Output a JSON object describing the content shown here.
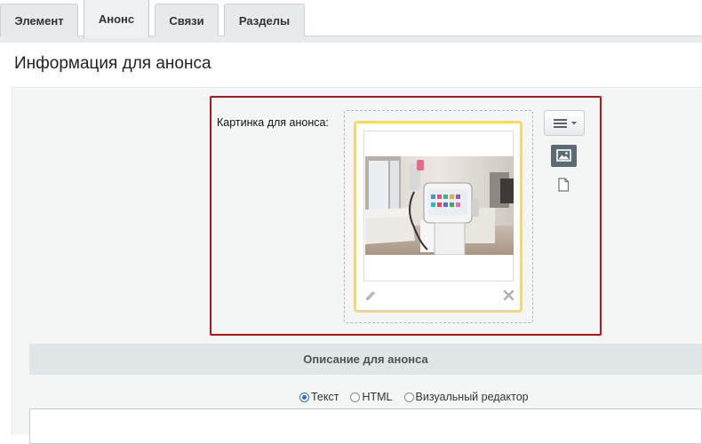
{
  "tabs": [
    {
      "label": "Элемент",
      "active": false
    },
    {
      "label": "Анонс",
      "active": true
    },
    {
      "label": "Связи",
      "active": false
    },
    {
      "label": "Разделы",
      "active": false
    }
  ],
  "section": {
    "title": "Информация для анонса"
  },
  "preview_image": {
    "label": "Картинка для анонса:",
    "edit_icon": "pencil-icon",
    "delete_icon": "close-icon"
  },
  "side_toolbar": {
    "menu_icon": "hamburger-menu-icon",
    "image_mode_icon": "image-icon",
    "file_mode_icon": "file-icon"
  },
  "description": {
    "header": "Описание для анонса",
    "modes": [
      {
        "label": "Текст",
        "checked": true
      },
      {
        "label": "HTML",
        "checked": false
      },
      {
        "label": "Визуальный редактор",
        "checked": false
      }
    ],
    "value": ""
  },
  "colors": {
    "highlight_frame": "#b9121b",
    "thumb_border": "#f1db70",
    "radio_accent": "#2c73c9"
  }
}
